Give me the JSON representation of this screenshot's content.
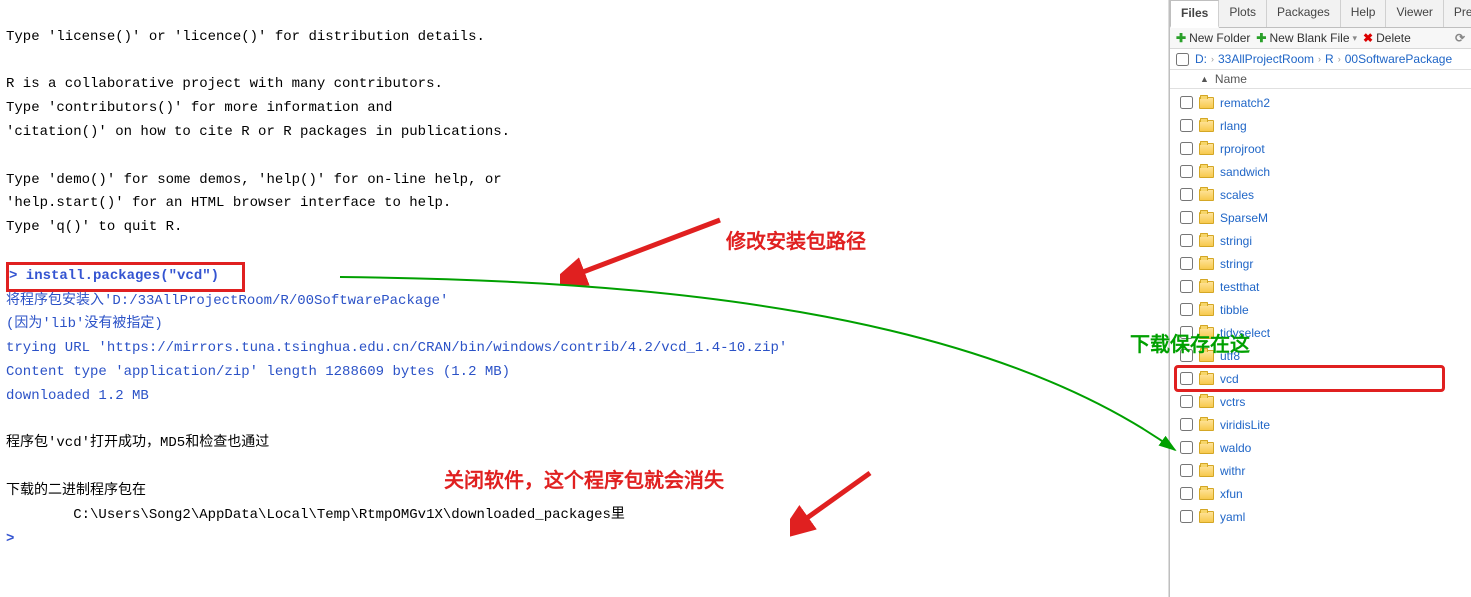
{
  "console": {
    "line1": "Type 'license()' or 'licence()' for distribution details.",
    "line2": "R is a collaborative project with many contributors.",
    "line3": "Type 'contributors()' for more information and",
    "line4": "'citation()' on how to cite R or R packages in publications.",
    "line5": "Type 'demo()' for some demos, 'help()' for on-line help, or",
    "line6": "'help.start()' for an HTML browser interface to help.",
    "line7": "Type 'q()' to quit R.",
    "prompt_cmd": "> install.packages(\"vcd\")",
    "info1": "将程序包安装入'D:/33AllProjectRoom/R/00SoftwarePackage'",
    "info2": "(因为'lib'没有被指定)",
    "url": "trying URL 'https://mirrors.tuna.tsinghua.edu.cn/CRAN/bin/windows/contrib/4.2/vcd_1.4-10.zip'",
    "contentLine": "Content type 'application/zip' length 1288609 bytes (1.2 MB)",
    "dlLine": "downloaded 1.2 MB",
    "okLine": "程序包'vcd'打开成功，MD5和检查也通过",
    "binLine": "下载的二进制程序包在",
    "pathLine": "        C:\\Users\\Song2\\AppData\\Local\\Temp\\RtmpOMGv1X\\downloaded_packages里",
    "finalPrompt": "> "
  },
  "annotations": {
    "red1": "修改安装包路径",
    "green": "下载保存在这",
    "red2": "关闭软件，这个程序包就会消失"
  },
  "tabs": {
    "files": "Files",
    "plots": "Plots",
    "packages": "Packages",
    "help": "Help",
    "viewer": "Viewer",
    "present": "Presenta"
  },
  "toolbar": {
    "newFolder": "New Folder",
    "newBlank": "New Blank File",
    "delete": "Delete"
  },
  "breadcrumb": {
    "drive": "D:",
    "seg1": "33AllProjectRoom",
    "seg2": "R",
    "seg3": "00SoftwarePackage"
  },
  "header": {
    "name": "Name"
  },
  "folders": [
    {
      "name": "rematch2"
    },
    {
      "name": "rlang"
    },
    {
      "name": "rprojroot"
    },
    {
      "name": "sandwich"
    },
    {
      "name": "scales"
    },
    {
      "name": "SparseM"
    },
    {
      "name": "stringi"
    },
    {
      "name": "stringr"
    },
    {
      "name": "testthat"
    },
    {
      "name": "tibble"
    },
    {
      "name": "tidyselect"
    },
    {
      "name": "utf8"
    },
    {
      "name": "vcd",
      "highlight": true
    },
    {
      "name": "vctrs"
    },
    {
      "name": "viridisLite"
    },
    {
      "name": "waldo"
    },
    {
      "name": "withr"
    },
    {
      "name": "xfun"
    },
    {
      "name": "yaml"
    }
  ]
}
